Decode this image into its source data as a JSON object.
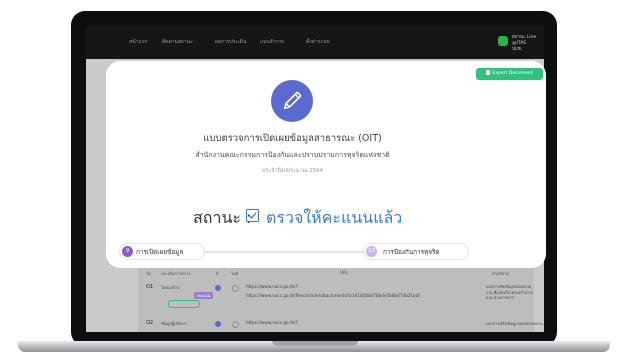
{
  "nav": {
    "items": [
      "หน้าแรก",
      "ติดตามสถานะ",
      "ผลการประเมิน",
      "แบบสำรวจ",
      "ตั้งค่าระบบ"
    ],
    "user_line1": "สถานะ Line @ITAS",
    "user_line2": "ปปช."
  },
  "modal": {
    "export_label": "Export Document",
    "title": "แบบตรวจการเปิดเผยข้อมูลสาธารณะ (OIT)",
    "subtitle": "สำนักงานคณะกรรมการป้องกันและปราบปรามการทุจริตแห่งชาติ",
    "fiscal_year": "ประจำปีงบประมาณ 2564",
    "status_label": "สถานะ :",
    "status_value": "ตรวจให้คะแนนแล้ว",
    "steps": [
      {
        "number": "9",
        "label": "การเปิดเผยข้อมูล",
        "color": "#8a5cc8"
      },
      {
        "number": "10",
        "label": "การป้องกันการทุจริต",
        "color": "#c9b3e8"
      }
    ]
  },
  "table": {
    "headers": [
      "ข้อ",
      "ประเด็นการตรวจ",
      "มี",
      "ไม่มี",
      "URL",
      "คำอธิบาย"
    ],
    "rows": [
      {
        "no": "O1",
        "topic": "โครงสร้าง",
        "badge": "คะแนน",
        "urls": [
          "https://www.nacc.go.th/?",
          "https://www.nacc.go.th/files/article/attachments/ts1614/0bbf78b4e5b8b474b2f.pdf"
        ],
        "note": "เอกสารหรือข้อมูลของหน่วยงาน ที่แสดงถึงโครงสร้างการแบ่ง ส่วนราชการ"
      },
      {
        "no": "O2",
        "topic": "ข้อมูลผู้บริหาร",
        "urls": [
          "https://www.nacc.go.th/?"
        ],
        "note": "เอกสารหรือข้อมูลของหน่วยงาน"
      }
    ]
  },
  "colors": {
    "accent": "#5a6ad0",
    "status": "#3a7bd5",
    "export": "#2ec27e",
    "line": "#2db24a"
  }
}
